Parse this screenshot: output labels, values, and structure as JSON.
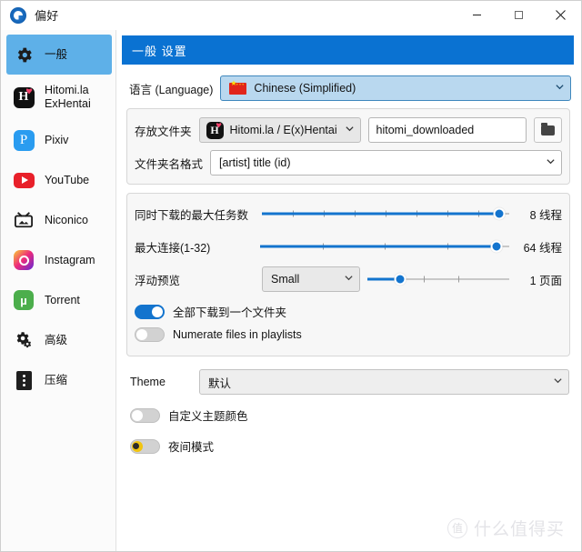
{
  "window": {
    "title": "偏好",
    "app_icon": "app-logo-icon",
    "controls": {
      "minimize": "minimize-icon",
      "maximize": "maximize-icon",
      "close": "close-icon"
    }
  },
  "sidebar": {
    "items": [
      {
        "label": "一般",
        "icon": "gear-icon",
        "active": true
      },
      {
        "label": "Hitomi.la\nExHentai",
        "icon": "hitomi-icon",
        "active": false
      },
      {
        "label": "Pixiv",
        "icon": "pixiv-icon",
        "active": false
      },
      {
        "label": "YouTube",
        "icon": "youtube-icon",
        "active": false
      },
      {
        "label": "Niconico",
        "icon": "niconico-icon",
        "active": false
      },
      {
        "label": "Instagram",
        "icon": "instagram-icon",
        "active": false
      },
      {
        "label": "Torrent",
        "icon": "torrent-icon",
        "active": false
      },
      {
        "label": "高级",
        "icon": "gears-icon",
        "active": false
      },
      {
        "label": "压缩",
        "icon": "compress-icon",
        "active": false
      }
    ]
  },
  "main": {
    "section_title": "一般 设置",
    "language": {
      "label": "语言 (Language)",
      "value": "Chinese (Simplified)",
      "flag": "flag-cn-icon",
      "chevron": "chevron-down-icon"
    },
    "storage": {
      "folder_label": "存放文件夹",
      "site_value": "Hitomi.la / E(x)Hentai",
      "site_icon": "hitomi-icon",
      "path_value": "hitomi_downloaded",
      "browse_icon": "folder-icon",
      "format_label": "文件夹名格式",
      "format_value": "[artist] title (id)"
    },
    "sliders": [
      {
        "label": "同时下载的最大任务数",
        "value": 8,
        "unit": "线程",
        "display": "8 线程",
        "percent": 96,
        "tick_count": 7
      },
      {
        "label": "最大连接(1-32)",
        "value": 64,
        "unit": "线程",
        "display": "64 线程",
        "percent": 95,
        "tick_count": 3
      }
    ],
    "preview": {
      "label": "浮动预览",
      "size_value": "Small",
      "slider_percent": 23,
      "value": 1,
      "unit": "页面",
      "display": "1 页面",
      "tick_count": 2
    },
    "toggles": [
      {
        "label": "全部下载到一个文件夹",
        "on": true,
        "style": "normal"
      },
      {
        "label": "Numerate files in playlists",
        "on": false,
        "style": "normal"
      }
    ],
    "theme": {
      "label": "Theme",
      "value": "默认",
      "toggles": [
        {
          "label": "自定义主题颜色",
          "on": false,
          "style": "normal"
        },
        {
          "label": "夜间模式",
          "on": false,
          "style": "moon"
        }
      ]
    }
  },
  "watermark": {
    "badge": "值",
    "text": "什么值得买"
  }
}
